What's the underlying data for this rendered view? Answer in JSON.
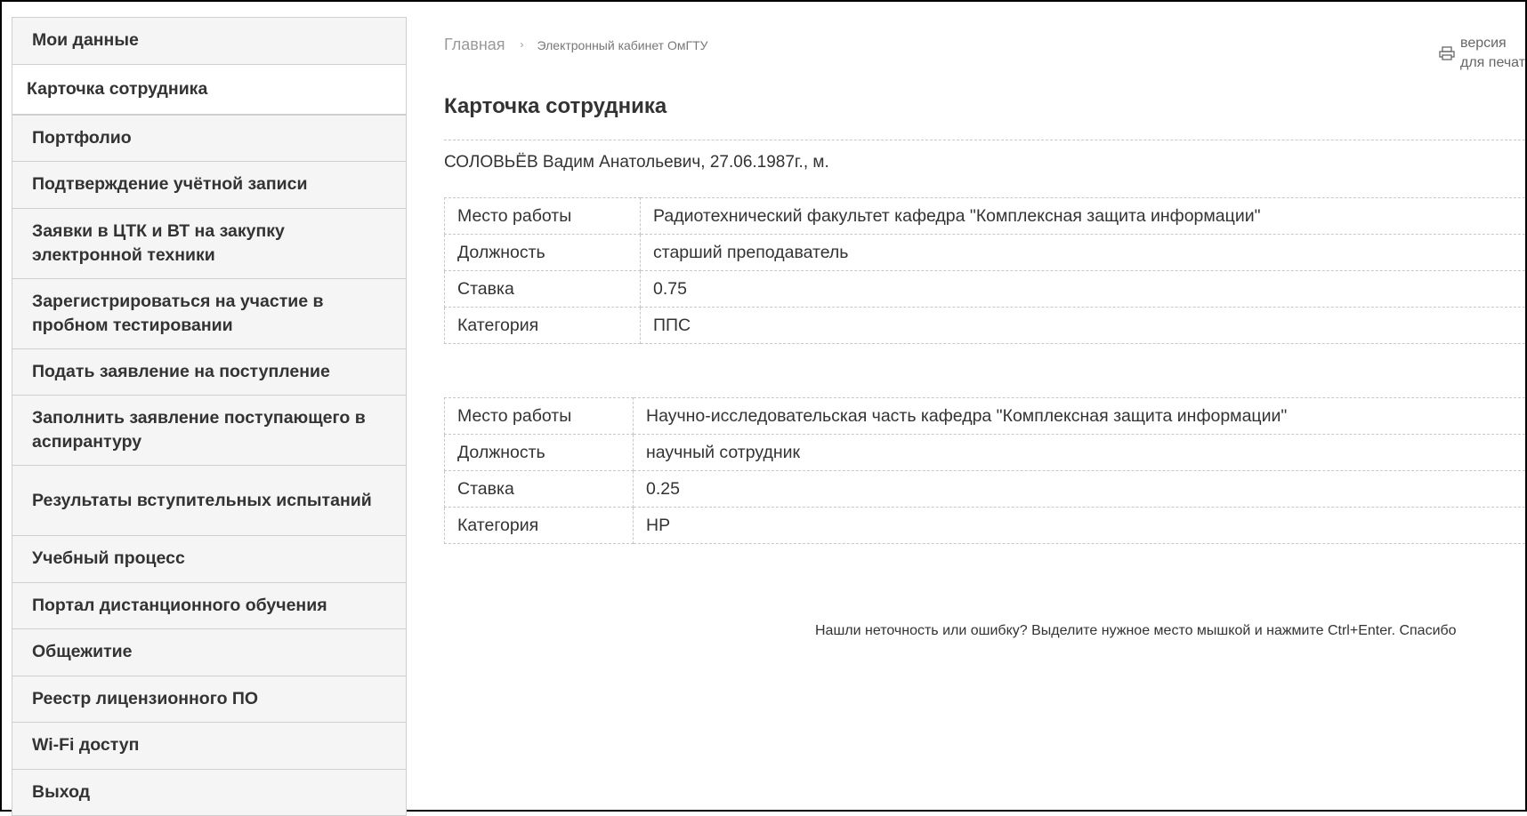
{
  "sidebar": {
    "items": [
      {
        "label": "Мои данные"
      },
      {
        "label": "Карточка сотрудника"
      },
      {
        "label": "Портфолио"
      },
      {
        "label": "Подтверждение учётной записи"
      },
      {
        "label": "Заявки в ЦТК и ВТ на закупку электронной техники"
      },
      {
        "label": "Зарегистрироваться на участие в пробном тестировании"
      },
      {
        "label": "Подать заявление на поступление"
      },
      {
        "label": "Заполнить заявление поступающего в аспирантуру"
      },
      {
        "label": "Результаты вступительных испытаний"
      },
      {
        "label": "Учебный процесс"
      },
      {
        "label": "Портал дистанционного обучения"
      },
      {
        "label": "Общежитие"
      },
      {
        "label": "Реестр лицензионного ПО"
      },
      {
        "label": "Wi-Fi доступ"
      },
      {
        "label": "Выход"
      }
    ]
  },
  "breadcrumb": {
    "home": "Главная",
    "separator": "›",
    "current": "Электронный кабинет ОмГТУ"
  },
  "print": {
    "line1": "версия",
    "line2": "для печат"
  },
  "page_title": "Карточка сотрудника",
  "person": "СОЛОВЬЁВ Вадим Анатольевич, 27.06.1987г., м.",
  "positions": [
    {
      "rows": [
        {
          "key": "Место работы",
          "value": "Радиотехнический факультет кафедра \"Комплексная защита информации\""
        },
        {
          "key": "Должность",
          "value": "старший преподаватель"
        },
        {
          "key": "Ставка",
          "value": "0.75"
        },
        {
          "key": "Категория",
          "value": "ППС"
        }
      ]
    },
    {
      "rows": [
        {
          "key": "Место работы",
          "value": "Научно-исследовательская часть кафедра \"Комплексная защита информации\""
        },
        {
          "key": "Должность",
          "value": "научный сотрудник"
        },
        {
          "key": "Ставка",
          "value": "0.25"
        },
        {
          "key": "Категория",
          "value": "НР"
        }
      ]
    }
  ],
  "notice": "Нашли неточность или ошибку? Выделите нужное место мышкой и нажмите Ctrl+Enter. Спасибо"
}
